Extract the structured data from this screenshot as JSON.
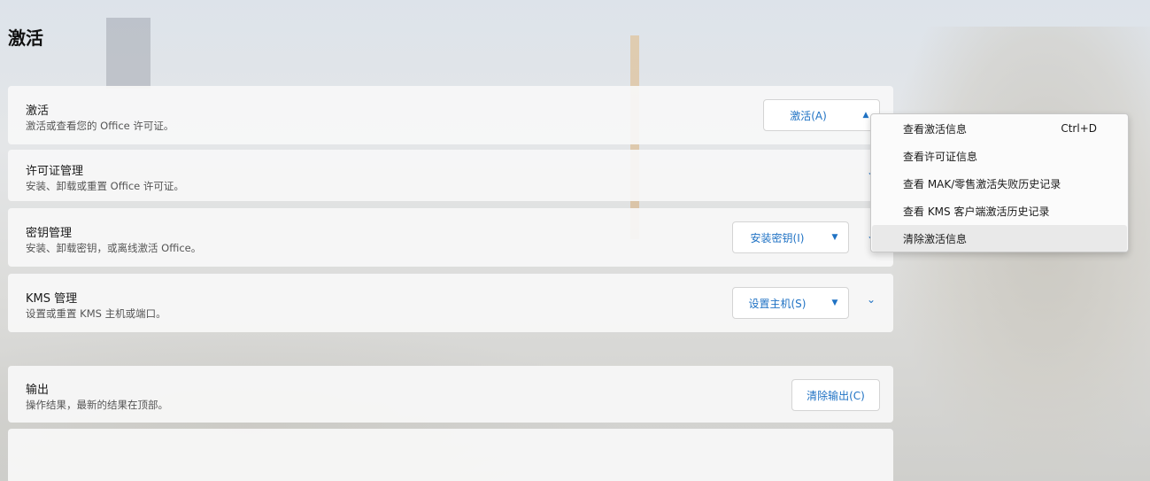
{
  "page": {
    "title": "激活"
  },
  "cards": {
    "activation": {
      "title": "激活",
      "desc": "激活或查看您的 Office 许可证。",
      "button": "激活(A)"
    },
    "license": {
      "title": "许可证管理",
      "desc": "安装、卸载或重置 Office 许可证。"
    },
    "key": {
      "title": "密钥管理",
      "desc": "安装、卸载密钥，或离线激活 Office。",
      "button": "安装密钥(I)"
    },
    "kms": {
      "title": "KMS 管理",
      "desc": "设置或重置 KMS 主机或端口。",
      "button": "设置主机(S)"
    },
    "output": {
      "title": "输出",
      "desc": "操作结果，最新的结果在顶部。",
      "button": "清除输出(C)"
    }
  },
  "menu": {
    "items": [
      {
        "label": "查看激活信息",
        "shortcut": "Ctrl+D"
      },
      {
        "label": "查看许可证信息"
      },
      {
        "label": "查看 MAK/零售激活失败历史记录"
      },
      {
        "label": "查看 KMS 客户端激活历史记录"
      },
      {
        "label": "清除激活信息"
      }
    ]
  },
  "icons": {
    "caret_down": "caret-down-icon",
    "caret_up": "caret-up-icon",
    "chevron": "chevron-down-icon"
  },
  "colors": {
    "accent": "#1f72c4"
  }
}
